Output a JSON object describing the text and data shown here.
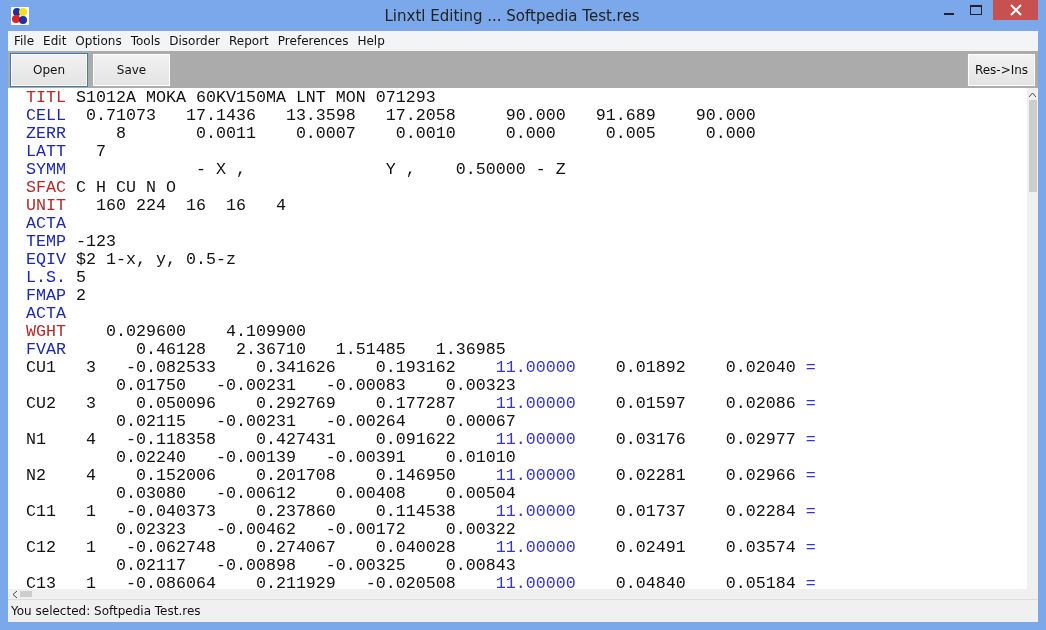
{
  "window": {
    "title": "Linxtl Editing ... Softpedia Test.res"
  },
  "menu": [
    "File",
    "Edit",
    "Options",
    "Tools",
    "Disorder",
    "Report",
    "Preferences",
    "Help"
  ],
  "toolbar": {
    "left": [
      {
        "label": "Open",
        "focused": true
      },
      {
        "label": "Save",
        "focused": false
      }
    ],
    "right": [
      {
        "label": "Res->Ins",
        "focused": false
      }
    ]
  },
  "editor": {
    "lines": [
      [
        {
          "text": "TITL",
          "color": "#b22a2a"
        },
        {
          "text": " S1012A MOKA 60KV150MA LNT MON 071293"
        }
      ],
      [
        {
          "text": "CELL",
          "color": "#1e2aa8"
        },
        {
          "text": "  0.71073   17.1436   13.3598   17.2058     90.000   91.689    90.000"
        }
      ],
      [
        {
          "text": "ZERR",
          "color": "#1e2aa8"
        },
        {
          "text": "     8       0.0011    0.0007    0.0010     0.000     0.005     0.000"
        }
      ],
      [
        {
          "text": "LATT",
          "color": "#1e2aa8"
        },
        {
          "text": "   7"
        }
      ],
      [
        {
          "text": "SYMM",
          "color": "#1e2aa8"
        },
        {
          "text": "             - X ,              Y ,    0.50000 - Z"
        }
      ],
      [
        {
          "text": "SFAC",
          "color": "#b22a2a"
        },
        {
          "text": " C H CU N O"
        }
      ],
      [
        {
          "text": "UNIT",
          "color": "#b22a2a"
        },
        {
          "text": "   160 224  16  16   4"
        }
      ],
      [
        {
          "text": "ACTA",
          "color": "#1e2aa8"
        }
      ],
      [
        {
          "text": "TEMP",
          "color": "#1e2aa8"
        },
        {
          "text": " -123"
        }
      ],
      [
        {
          "text": "EQIV",
          "color": "#1e2aa8"
        },
        {
          "text": " $2 1-x, y, 0.5-z"
        }
      ],
      [
        {
          "text": "L.S.",
          "color": "#1e2aa8"
        },
        {
          "text": " 5"
        }
      ],
      [
        {
          "text": "FMAP",
          "color": "#1e2aa8"
        },
        {
          "text": " 2"
        }
      ],
      [
        {
          "text": "ACTA",
          "color": "#1e2aa8"
        }
      ],
      [
        {
          "text": "WGHT",
          "color": "#b22a2a"
        },
        {
          "text": "    0.029600    4.109900"
        }
      ],
      [
        {
          "text": "FVAR",
          "color": "#1e2aa8"
        },
        {
          "text": "       0.46128   2.36710   1.51485   1.36985"
        }
      ],
      [
        {
          "text": "CU1   3   -0.082533    0.341626    0.193162    "
        },
        {
          "text": "11.00000",
          "color": "#3535c8"
        },
        {
          "text": "    0.01892    0.02040 "
        },
        {
          "text": "=",
          "color": "#3535c8"
        }
      ],
      [
        {
          "text": "         0.01750   -0.00231   -0.00083    0.00323"
        }
      ],
      [
        {
          "text": "CU2   3    0.050096    0.292769    0.177287    "
        },
        {
          "text": "11.00000",
          "color": "#3535c8"
        },
        {
          "text": "    0.01597    0.02086 "
        },
        {
          "text": "=",
          "color": "#3535c8"
        }
      ],
      [
        {
          "text": "         0.02115   -0.00231   -0.00264    0.00067"
        }
      ],
      [
        {
          "text": "N1    4   -0.118358    0.427431    0.091622    "
        },
        {
          "text": "11.00000",
          "color": "#3535c8"
        },
        {
          "text": "    0.03176    0.02977 "
        },
        {
          "text": "=",
          "color": "#3535c8"
        }
      ],
      [
        {
          "text": "         0.02240   -0.00139   -0.00391    0.01010"
        }
      ],
      [
        {
          "text": "N2    4    0.152006    0.201708    0.146950    "
        },
        {
          "text": "11.00000",
          "color": "#3535c8"
        },
        {
          "text": "    0.02281    0.02966 "
        },
        {
          "text": "=",
          "color": "#3535c8"
        }
      ],
      [
        {
          "text": "         0.03080   -0.00612    0.00408    0.00504"
        }
      ],
      [
        {
          "text": "C11   1   -0.040373    0.237860    0.114538    "
        },
        {
          "text": "11.00000",
          "color": "#3535c8"
        },
        {
          "text": "    0.01737    0.02284 "
        },
        {
          "text": "=",
          "color": "#3535c8"
        }
      ],
      [
        {
          "text": "         0.02323   -0.00462   -0.00172    0.00322"
        }
      ],
      [
        {
          "text": "C12   1   -0.062748    0.274067    0.040028    "
        },
        {
          "text": "11.00000",
          "color": "#3535c8"
        },
        {
          "text": "    0.02491    0.03574 "
        },
        {
          "text": "=",
          "color": "#3535c8"
        }
      ],
      [
        {
          "text": "         0.02117   -0.00898   -0.00325    0.00843"
        }
      ],
      [
        {
          "text": "C13   1   -0.086064    0.211929   -0.020508    "
        },
        {
          "text": "11.00000",
          "color": "#3535c8"
        },
        {
          "text": "    0.04840    0.05184 "
        },
        {
          "text": "=",
          "color": "#3535c8"
        }
      ]
    ]
  },
  "status_bar": "You selected: Softpedia Test.res"
}
